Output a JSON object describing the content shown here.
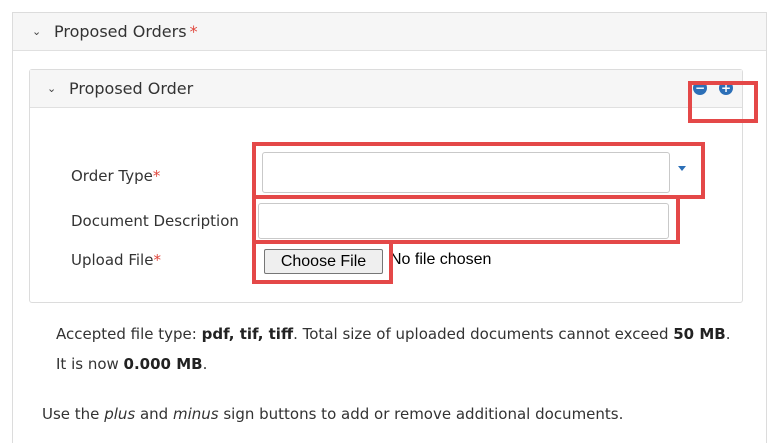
{
  "outer": {
    "title": "Proposed Orders",
    "required_mark": "*",
    "chevron": "chevron-down-icon"
  },
  "inner": {
    "title": "Proposed Order",
    "remove_button": "−",
    "add_button": "+"
  },
  "form": {
    "order_type_label": "Order Type",
    "order_type_required": "*",
    "order_type_value": "",
    "document_description_label": "Document Description",
    "document_description_value": "",
    "upload_file_label": "Upload File",
    "upload_file_required": "*",
    "choose_file_label": "Choose File",
    "no_file_text": "No file chosen"
  },
  "info": {
    "line1_prefix": "Accepted file type: ",
    "file_types": "pdf, tif, tiff",
    "line1_mid": ". Total size of uploaded documents cannot exceed ",
    "max_size": "50 MB",
    "line1_end": ".",
    "line2_prefix": "It is now ",
    "current_size": "0.000 MB",
    "line2_end": ".",
    "line3_a": "Use the ",
    "plus_word": "plus",
    "line3_b": " and ",
    "minus_word": "minus",
    "line3_c": " sign buttons to add or remove additional documents."
  },
  "colors": {
    "accent": "#2c6fb7",
    "required": "#e0463c",
    "highlight": "#e44848"
  }
}
